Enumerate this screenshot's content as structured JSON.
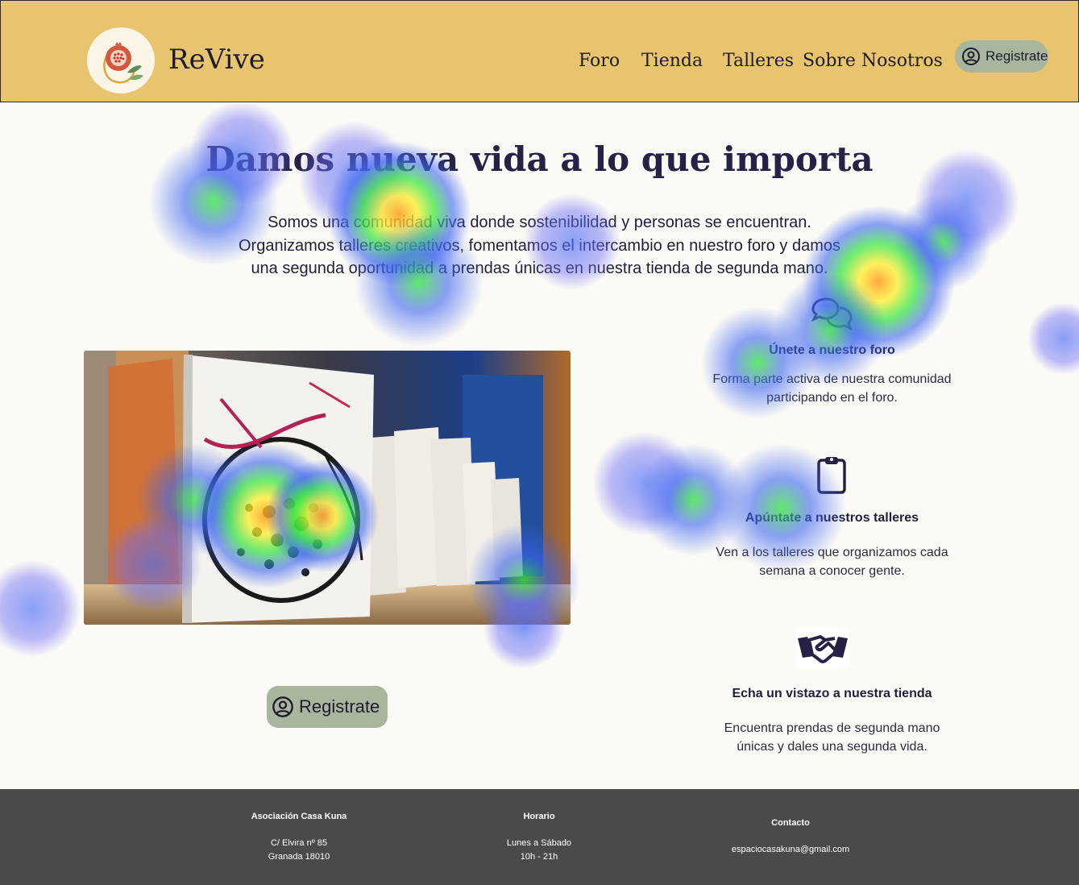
{
  "header": {
    "brand": "ReVive",
    "nav": [
      "Foro",
      "Tienda",
      "Talleres",
      "Sobre Nosotros"
    ],
    "register_label": "Registrate"
  },
  "hero": {
    "title": "Damos nueva vida a lo que importa",
    "lines": [
      "Somos una comunidad viva donde sostenibilidad y personas se encuentran.",
      "Organizamos talleres creativos, fomentamos el intercambio en nuestro foro y damos",
      "una segunda oportunidad a prendas únicas en nuestra tienda de segunda mano."
    ]
  },
  "cta": {
    "register_label": "Registrate"
  },
  "features": [
    {
      "icon": "chat-bubbles-icon",
      "title": "Únete a nuestro foro",
      "desc": [
        "Forma parte activa de nuestra comunidad",
        "participando en el foro."
      ]
    },
    {
      "icon": "clipboard-icon",
      "title": "Apúntate a nuestros talleres",
      "desc": [
        "Ven a los talleres que organizamos cada",
        "semana a conocer gente."
      ]
    },
    {
      "icon": "handshake-icon",
      "title": "Echa un vistazo a nuestra tienda",
      "desc": [
        "Encuentra prendas de segunda mano",
        "únicas y dales una segunda vida."
      ]
    }
  ],
  "footer": {
    "org": {
      "title": "Asociación Casa Kuna",
      "lines": [
        "C/ Elvira nº 85",
        "Granada 18010"
      ]
    },
    "hours": {
      "title": "Horario",
      "lines": [
        "Lunes a Sábado",
        "10h - 21h"
      ]
    },
    "contact": {
      "title": "Contacto",
      "lines": [
        "espaciocasakuna@gmail.com"
      ]
    }
  },
  "colors": {
    "header_bg": "#e8c46e",
    "button_bg": "#a7b69d",
    "title_color": "#262246",
    "footer_bg": "#4a4a4a"
  }
}
